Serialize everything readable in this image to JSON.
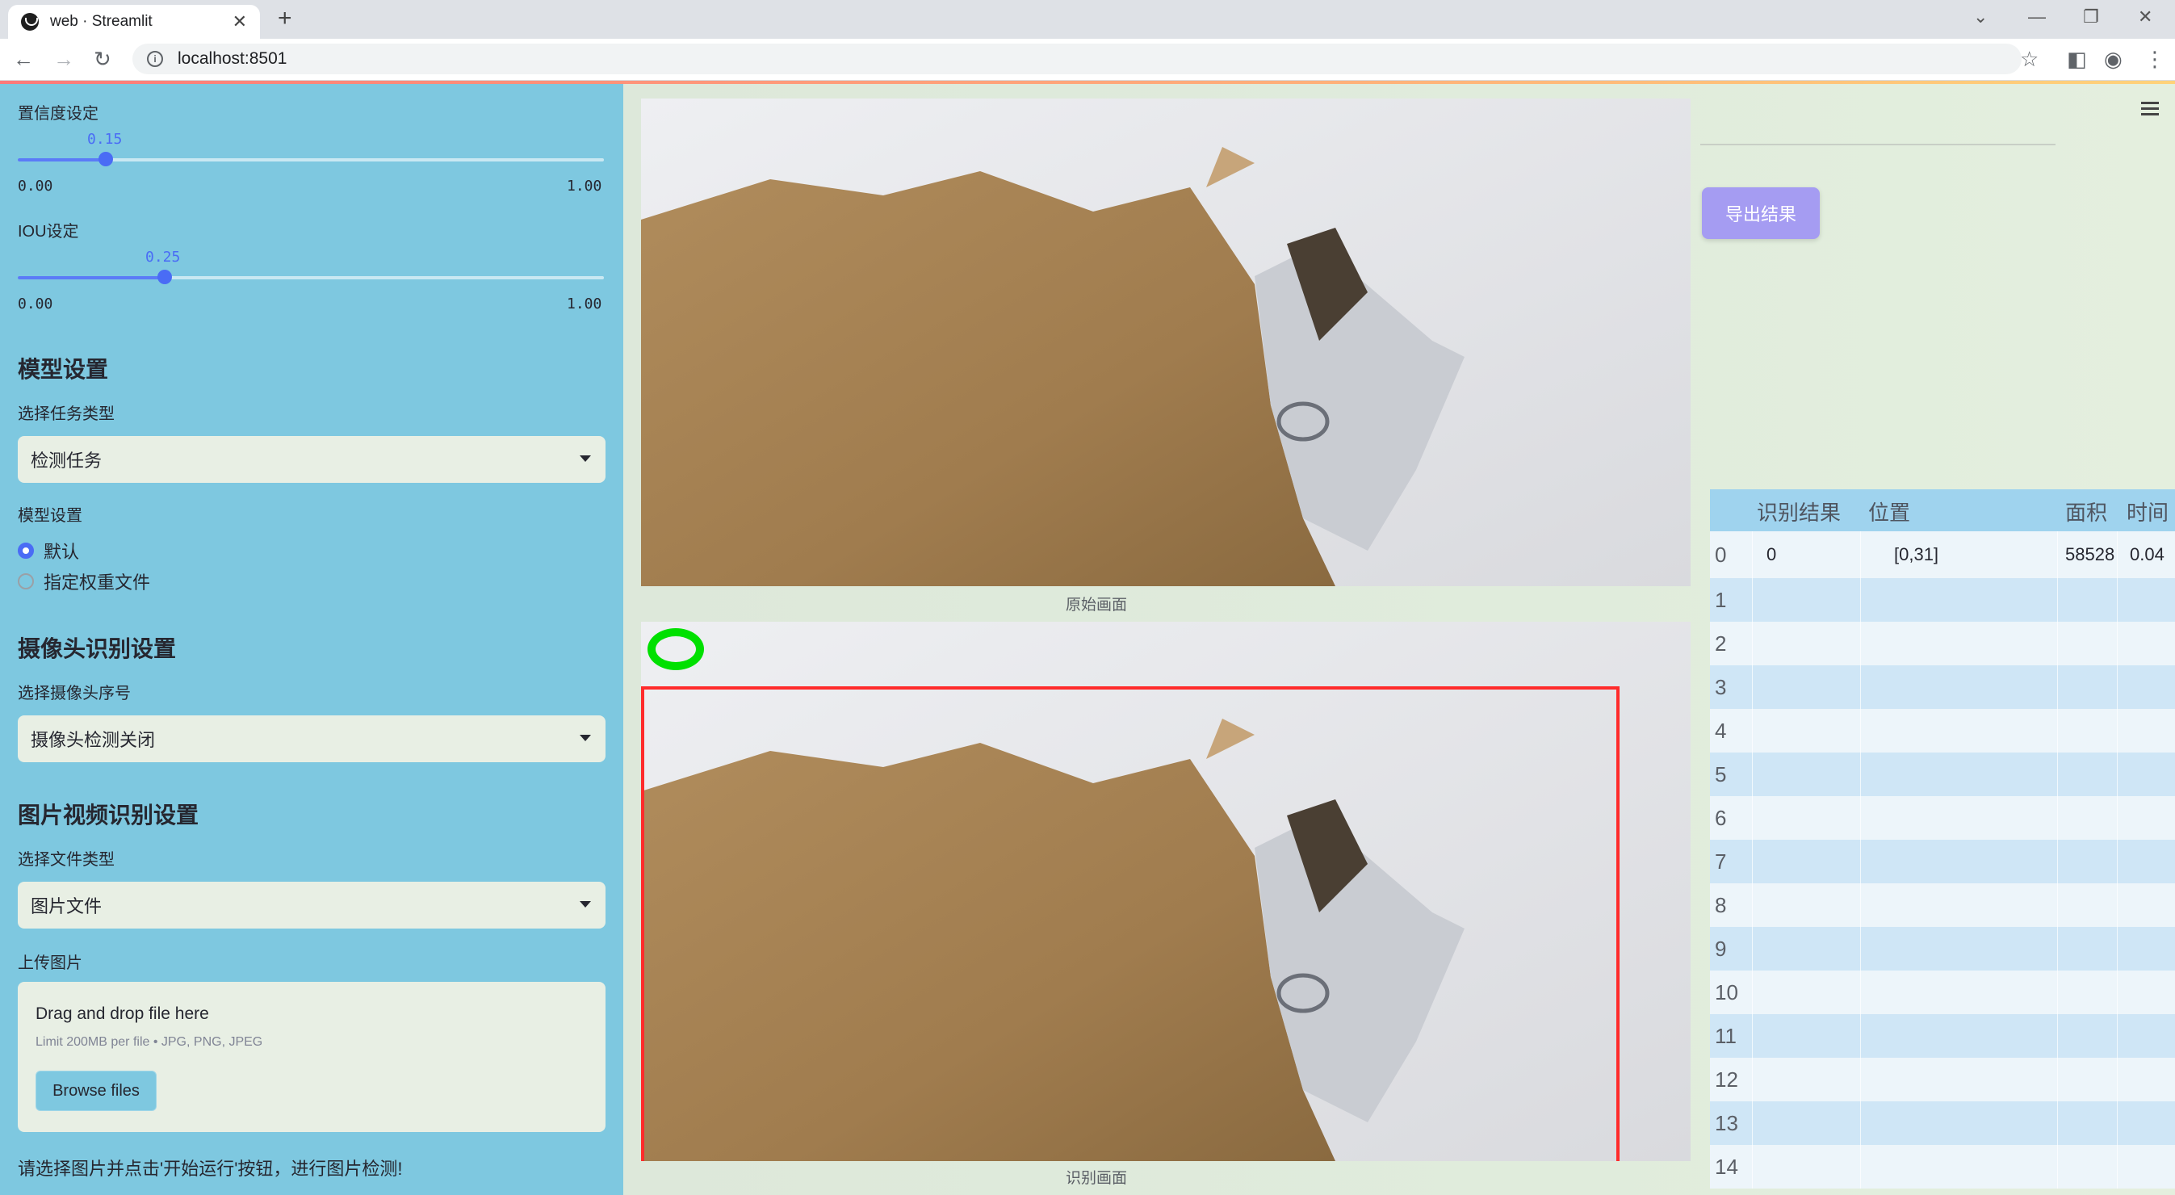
{
  "browser": {
    "tab_title": "web · Streamlit",
    "url": "localhost:8501"
  },
  "sidebar": {
    "confidence": {
      "label": "置信度设定",
      "value": "0.15",
      "fraction": 0.15,
      "min": "0.00",
      "max": "1.00"
    },
    "iou": {
      "label": "IOU设定",
      "value": "0.25",
      "fraction": 0.25,
      "min": "0.00",
      "max": "1.00"
    },
    "model_heading": "模型设置",
    "task_label": "选择任务类型",
    "task_value": "检测任务",
    "model_label": "模型设置",
    "model_options": [
      {
        "label": "默认",
        "checked": true
      },
      {
        "label": "指定权重文件",
        "checked": false
      }
    ],
    "camera_heading": "摄像头识别设置",
    "camera_label": "选择摄像头序号",
    "camera_value": "摄像头检测关闭",
    "media_heading": "图片视频识别设置",
    "filetype_label": "选择文件类型",
    "filetype_value": "图片文件",
    "upload_label": "上传图片",
    "uploader": {
      "title": "Drag and drop file here",
      "limit": "Limit 200MB per file • JPG, PNG, JPEG",
      "button": "Browse files"
    },
    "note": "请选择图片并点击'开始运行'按钮，进行图片检测!"
  },
  "main": {
    "original_caption": "原始画面",
    "detected_caption": "识别画面",
    "export_button": "导出结果"
  },
  "table": {
    "headers": [
      "",
      "识别结果",
      "位置",
      "面积",
      "时间"
    ],
    "rows": [
      [
        "0",
        "0",
        "[0,31]",
        "58528",
        "0.04"
      ],
      [
        "1",
        "",
        "",
        "",
        ""
      ],
      [
        "2",
        "",
        "",
        "",
        ""
      ],
      [
        "3",
        "",
        "",
        "",
        ""
      ],
      [
        "4",
        "",
        "",
        "",
        ""
      ],
      [
        "5",
        "",
        "",
        "",
        ""
      ],
      [
        "6",
        "",
        "",
        "",
        ""
      ],
      [
        "7",
        "",
        "",
        "",
        ""
      ],
      [
        "8",
        "",
        "",
        "",
        ""
      ],
      [
        "9",
        "",
        "",
        "",
        ""
      ],
      [
        "10",
        "",
        "",
        "",
        ""
      ],
      [
        "11",
        "",
        "",
        "",
        ""
      ],
      [
        "12",
        "",
        "",
        "",
        ""
      ],
      [
        "13",
        "",
        "",
        "",
        ""
      ],
      [
        "14",
        "",
        "",
        "",
        ""
      ]
    ]
  },
  "colors": {
    "sidebar_bg": "#7ec8e0",
    "accent": "#4a6cf5",
    "export_btn": "#a59cf2",
    "detect_box": "#ff2b2b",
    "ring": "#00e000"
  }
}
